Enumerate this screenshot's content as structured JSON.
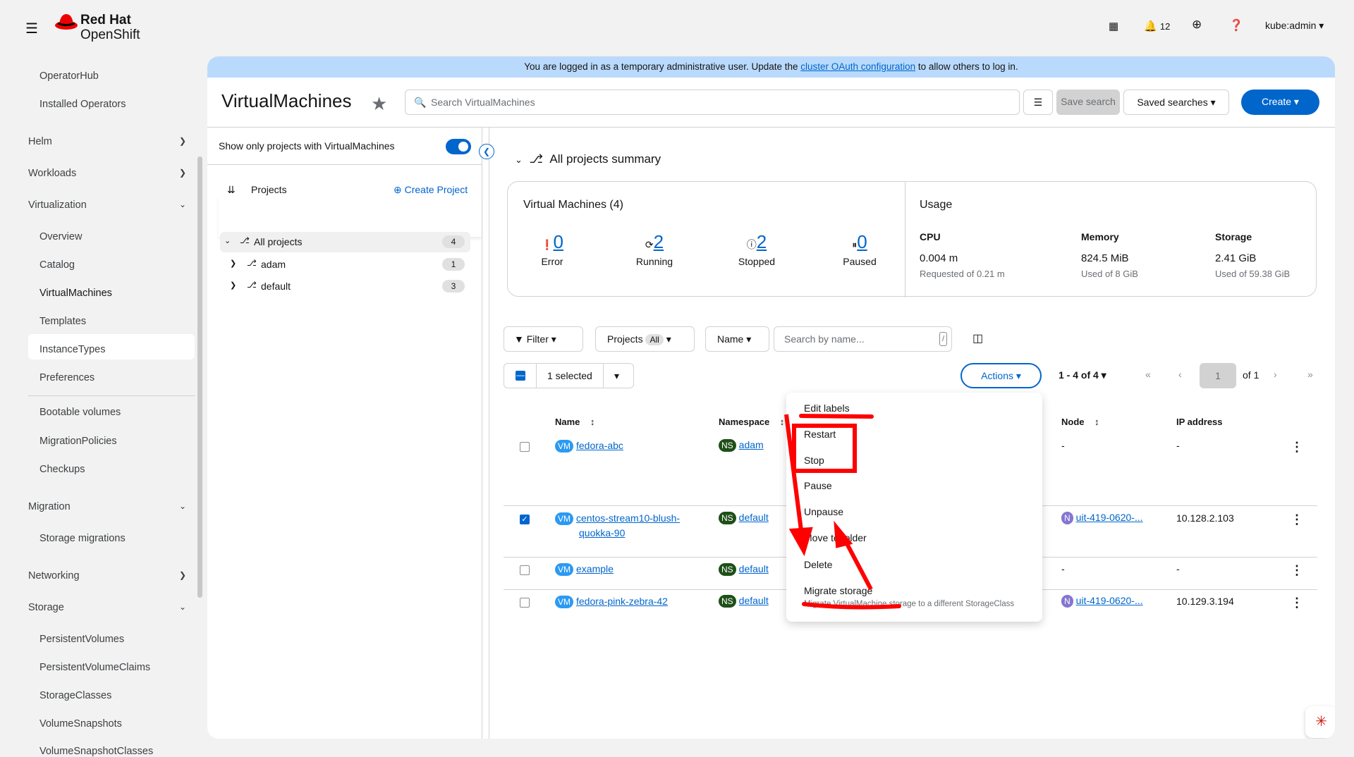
{
  "masthead": {
    "brand_line1": "Red Hat",
    "brand_line2": "OpenShift",
    "notifications": "12",
    "user": "kube:admin"
  },
  "sidebar": {
    "items": [
      "OperatorHub",
      "Installed Operators"
    ],
    "sections": [
      "Helm",
      "Workloads",
      "Virtualization",
      "Migration",
      "Networking",
      "Storage"
    ],
    "virt_items": [
      "Overview",
      "Catalog",
      "VirtualMachines",
      "Templates",
      "InstanceTypes",
      "Preferences",
      "Bootable volumes",
      "MigrationPolicies",
      "Checkups"
    ],
    "migration_items": [
      "Storage migrations"
    ],
    "storage_items": [
      "PersistentVolumes",
      "PersistentVolumeClaims",
      "StorageClasses",
      "VolumeSnapshots",
      "VolumeSnapshotClasses"
    ]
  },
  "banner": {
    "text": "You are logged in as a temporary administrative user. Update the ",
    "link": "cluster OAuth configuration",
    "text2": " to allow others to log in."
  },
  "header": {
    "title": "VirtualMachines",
    "search_placeholder": "Search VirtualMachines",
    "save_search": "Save search",
    "saved_searches": "Saved searches",
    "create": "Create"
  },
  "projects_panel": {
    "toggle_label": "Show only projects with VirtualMachines",
    "projects_label": "Projects",
    "create_project": "Create Project",
    "tree": [
      {
        "name": "All projects",
        "count": "4"
      },
      {
        "name": "adam",
        "count": "1"
      },
      {
        "name": "default",
        "count": "3"
      }
    ]
  },
  "summary": {
    "title": "All projects summary",
    "vm_title": "Virtual Machines (4)",
    "stats": [
      {
        "label": "Error",
        "value": "0"
      },
      {
        "label": "Running",
        "value": "2"
      },
      {
        "label": "Stopped",
        "value": "2"
      },
      {
        "label": "Paused",
        "value": "0"
      }
    ],
    "usage_title": "Usage",
    "usage": [
      {
        "label": "CPU",
        "value": "0.004 m",
        "sub": "Requested of 0.21 m"
      },
      {
        "label": "Memory",
        "value": "824.5 MiB",
        "sub": "Used of 8 GiB"
      },
      {
        "label": "Storage",
        "value": "2.41 GiB",
        "sub": "Used of 59.38 GiB"
      }
    ]
  },
  "toolbar": {
    "filter": "Filter",
    "projects": "Projects",
    "projects_badge": "All",
    "name": "Name",
    "search_placeholder": "Search by name...",
    "slash": "/",
    "selected": "1 selected",
    "actions": "Actions",
    "range": "1 - 4 of 4",
    "page": "1",
    "of_pages": "of 1"
  },
  "table": {
    "headers": [
      "Name",
      "Namespace",
      "Node",
      "IP address"
    ],
    "rows": [
      {
        "name": "fedora-abc",
        "namespace": "adam",
        "node": "-",
        "ip": "-",
        "checked": false
      },
      {
        "name": "centos-stream10-blush-",
        "name2": "quokka-90",
        "namespace": "default",
        "node": "uit-419-0620-...",
        "ip": "10.128.2.103",
        "checked": true
      },
      {
        "name": "example",
        "namespace": "default",
        "node": "-",
        "ip": "-",
        "checked": false
      },
      {
        "name": "fedora-pink-zebra-42",
        "namespace": "default",
        "node": "uit-419-0620-...",
        "ip": "10.129.3.194",
        "checked": false
      }
    ]
  },
  "badges": {
    "vm": "VM",
    "ns": "NS",
    "node": "N"
  },
  "actions_menu": {
    "items": [
      "Edit labels",
      "Restart",
      "Stop",
      "Pause",
      "Unpause",
      "Move to folder",
      "Delete",
      "Migrate storage"
    ],
    "migrate_desc": "Migrate VirtualMachine storage to a different StorageClass"
  },
  "colors": {
    "primary": "#0066cc",
    "annotation": "#ff0000"
  }
}
